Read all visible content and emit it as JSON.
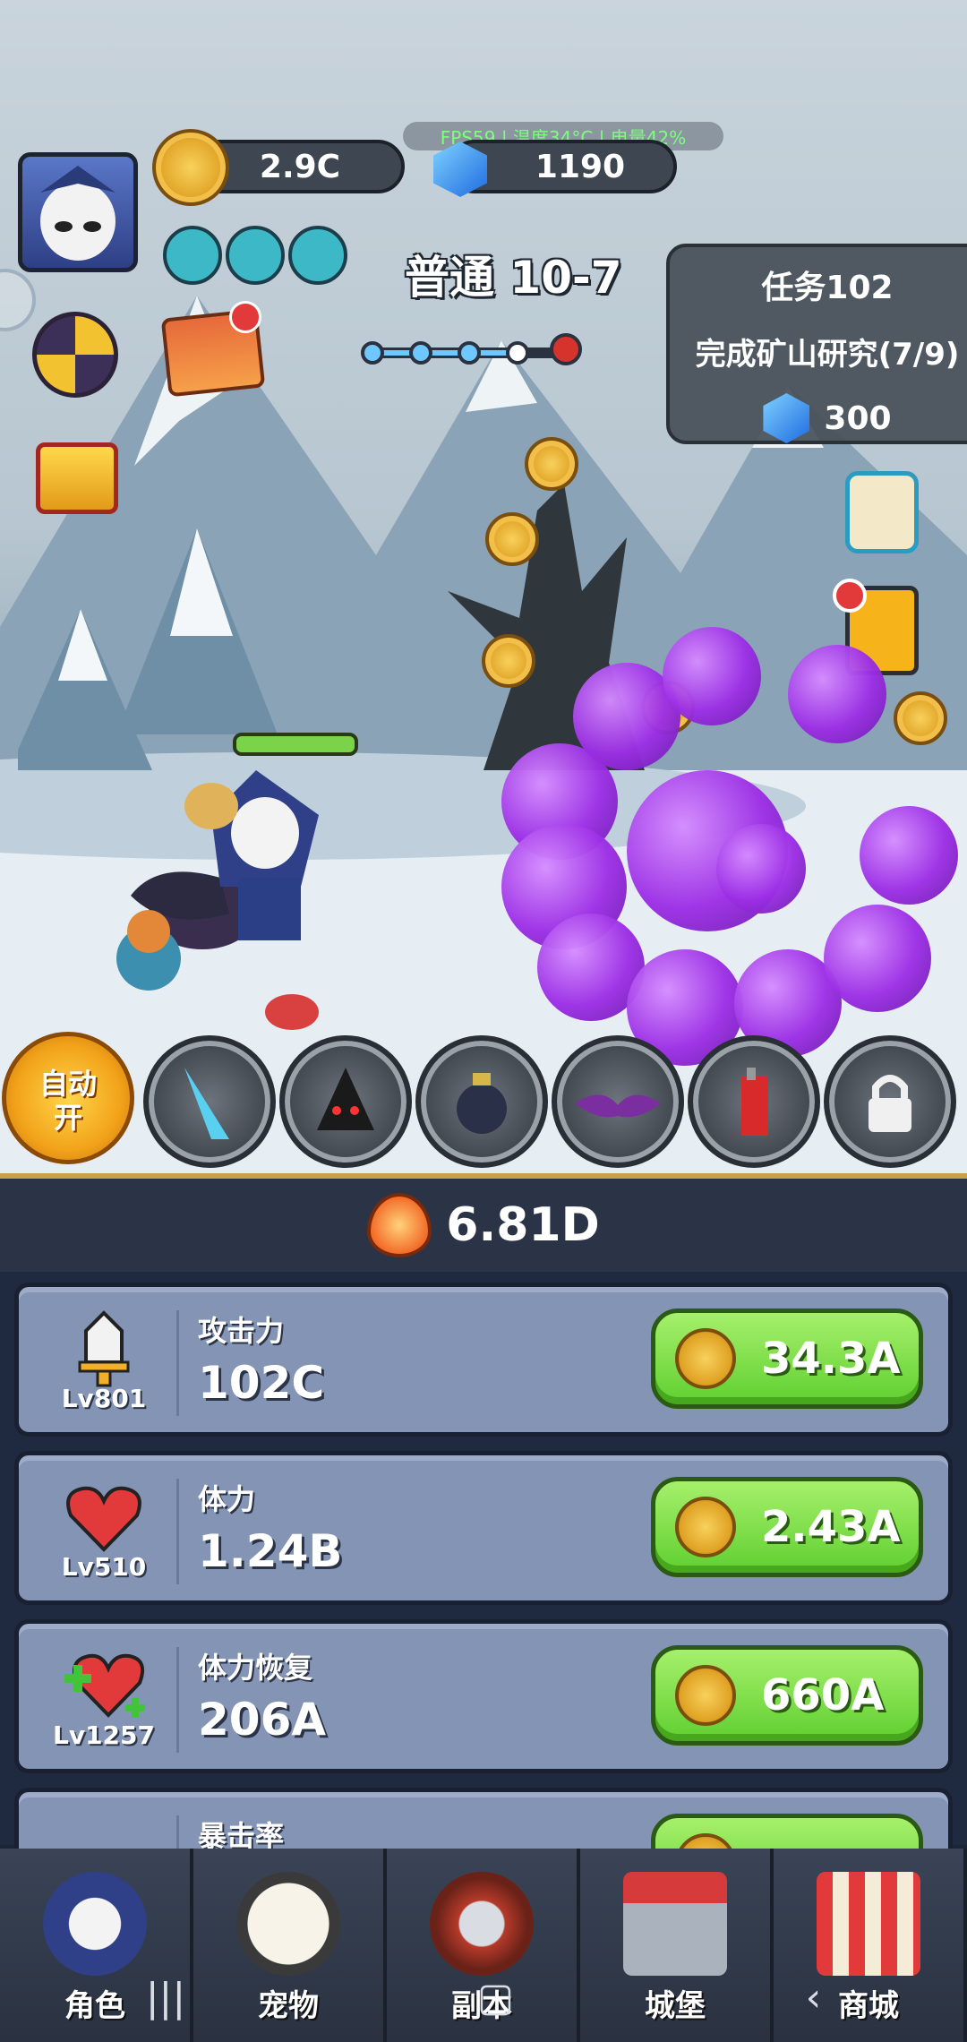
{
  "hud": {
    "gold": "2.9C",
    "gems": "1190",
    "fps_overlay": "FPS59 | 温度34°C | 电量42%",
    "stage": "普通 10-7"
  },
  "quest": {
    "title": "任务102",
    "desc": "完成矿山研究(7/9)",
    "reward": "300"
  },
  "skills": {
    "auto_label_1": "自动",
    "auto_label_2": "开",
    "slots": [
      "ice-shard",
      "shadow-hood",
      "bomb",
      "bat",
      "dynamite",
      "lock"
    ]
  },
  "power": "6.81D",
  "upgrades": [
    {
      "name": "攻击力",
      "level": "Lv801",
      "value": "102C",
      "cost": "34.3A",
      "icon": "sword-icon"
    },
    {
      "name": "体力",
      "level": "Lv510",
      "value": "1.24B",
      "cost": "2.43A",
      "icon": "heart-icon"
    },
    {
      "name": "体力恢复",
      "level": "Lv1257",
      "value": "206A",
      "cost": "660A",
      "icon": "heart-plus-icon"
    },
    {
      "name": "暴击率",
      "level": "",
      "value": "",
      "cost": "",
      "icon": "claw-icon"
    }
  ],
  "nav": [
    {
      "label": "角色"
    },
    {
      "label": "宠物"
    },
    {
      "label": "副本"
    },
    {
      "label": "城堡"
    },
    {
      "label": "商城"
    }
  ],
  "colors": {
    "buy_green": "#6ad43a",
    "panel_blue": "#8494b5",
    "smoke_purple": "#9c2ee6"
  }
}
